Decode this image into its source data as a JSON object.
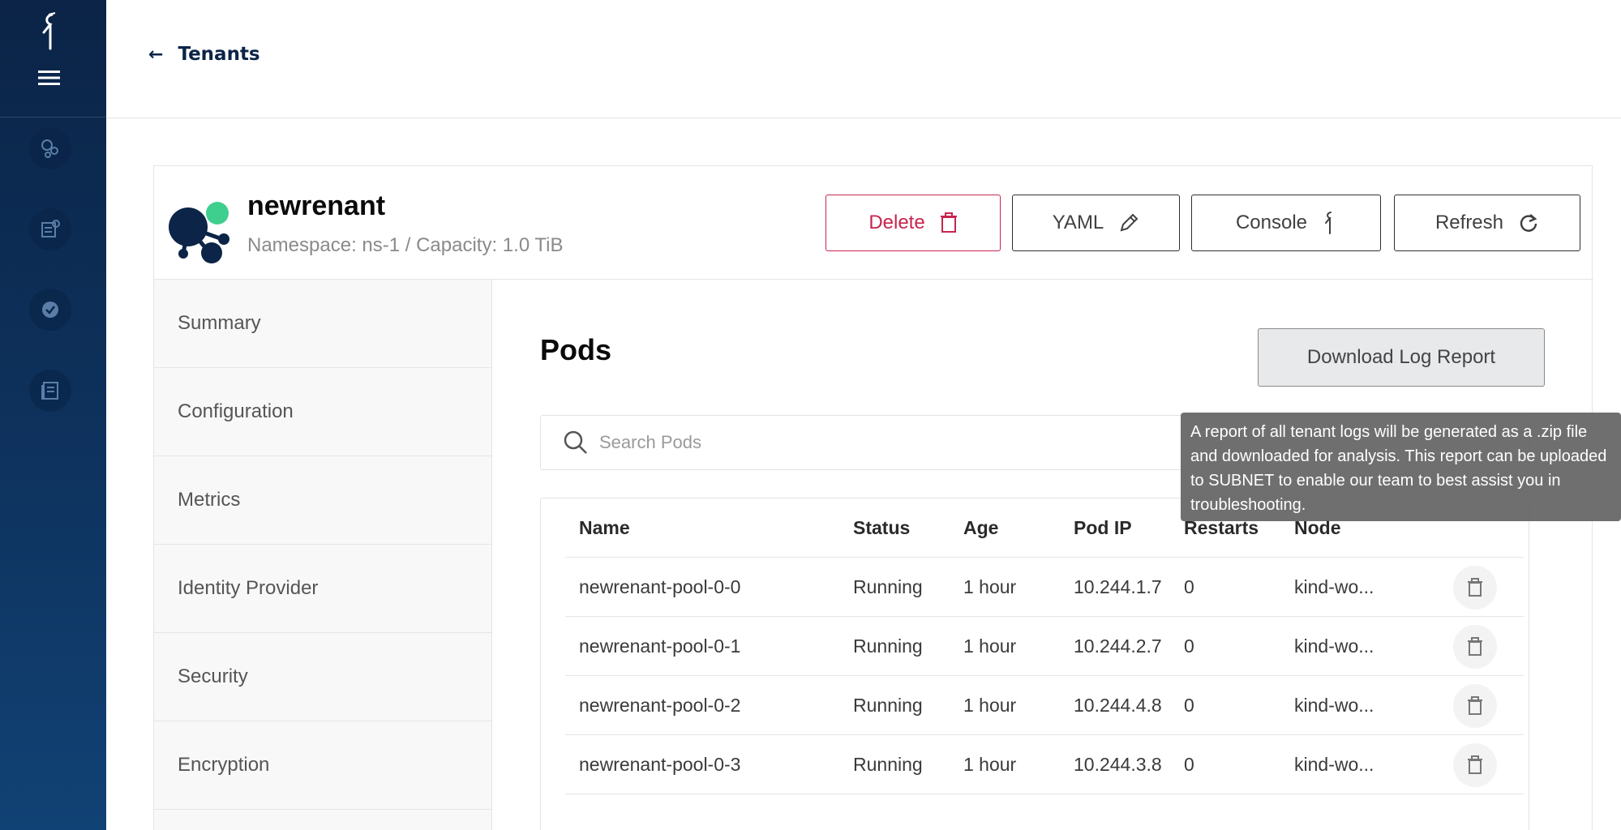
{
  "nav": {
    "back_label": "Tenants"
  },
  "tenant": {
    "name": "newrenant",
    "subtitle": "Namespace: ns-1 / Capacity: 1.0 TiB"
  },
  "actions": {
    "delete": "Delete",
    "yaml": "YAML",
    "console": "Console",
    "refresh": "Refresh"
  },
  "tabs": [
    {
      "label": "Summary"
    },
    {
      "label": "Configuration"
    },
    {
      "label": "Metrics"
    },
    {
      "label": "Identity Provider"
    },
    {
      "label": "Security"
    },
    {
      "label": "Encryption"
    }
  ],
  "pods": {
    "title": "Pods",
    "download_label": "Download Log Report",
    "search_placeholder": "Search Pods",
    "columns": [
      "Name",
      "Status",
      "Age",
      "Pod IP",
      "Restarts",
      "Node"
    ],
    "rows": [
      {
        "name": "newrenant-pool-0-0",
        "status": "Running",
        "age": "1 hour",
        "ip": "10.244.1.7",
        "restarts": "0",
        "node": "kind-wo..."
      },
      {
        "name": "newrenant-pool-0-1",
        "status": "Running",
        "age": "1 hour",
        "ip": "10.244.2.7",
        "restarts": "0",
        "node": "kind-wo..."
      },
      {
        "name": "newrenant-pool-0-2",
        "status": "Running",
        "age": "1 hour",
        "ip": "10.244.4.8",
        "restarts": "0",
        "node": "kind-wo..."
      },
      {
        "name": "newrenant-pool-0-3",
        "status": "Running",
        "age": "1 hour",
        "ip": "10.244.3.8",
        "restarts": "0",
        "node": "kind-wo..."
      }
    ]
  },
  "tooltip": {
    "text": "A report of all tenant logs will be generated as a .zip file and downloaded for analysis. This report can be uploaded to SUBNET to enable our team to best assist you in troubleshooting."
  },
  "colors": {
    "sidebar": "#0b2447",
    "delete": "#c7254e",
    "accent_green": "#3ecf8e",
    "navy": "#0b2447"
  },
  "icons": {
    "brand": "minio-bird-icon",
    "menu": "hamburger-menu-icon",
    "back": "arrow-left-icon",
    "delete": "trash-icon",
    "yaml": "pencil-icon",
    "console": "minio-bird-icon",
    "refresh": "refresh-icon",
    "search": "search-icon"
  }
}
